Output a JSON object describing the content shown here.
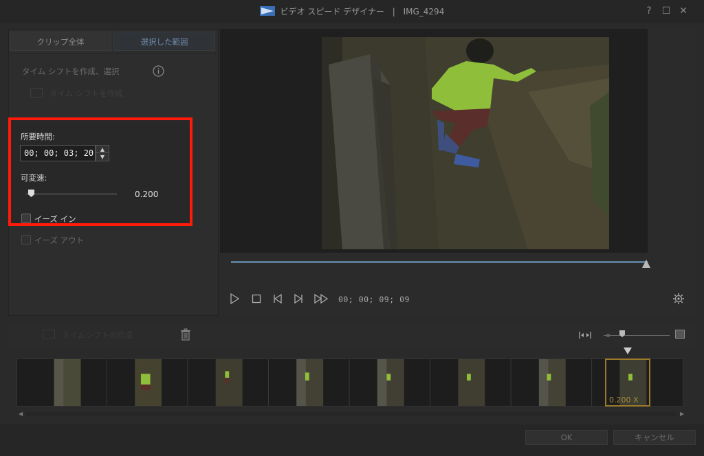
{
  "window": {
    "title": "ビデオ スピード デザイナー",
    "separator": "|",
    "filename": "IMG_4294",
    "help_glyph": "?",
    "maximize_glyph": "☐",
    "close_glyph": "✕"
  },
  "tabs": [
    {
      "label": "クリップ全体"
    },
    {
      "label": "選択した範囲"
    }
  ],
  "left_panel": {
    "section_label": "タイム シフトを作成、選択",
    "create_button_label": "タイム シフトを作成",
    "duration_label": "所要時間:",
    "duration_value": "00; 00; 03; 20",
    "speed_label": "可変速:",
    "speed_value": "0.200",
    "speed_level_fraction": 0.03,
    "ease_in_label": "イーズ イン",
    "ease_out_label": "イーズ アウト",
    "ease_in_checked": false,
    "ease_out_checked": false
  },
  "player": {
    "timecode": "00; 00; 09; 09",
    "progress_fraction": 0.99
  },
  "timeline": {
    "create_label": "タイムシフトの作成",
    "range_label": "0.200 X",
    "thumbnails": 8
  },
  "footer": {
    "ok_label": "OK",
    "cancel_label": "キャンセル"
  },
  "colors": {
    "highlight": "#ff1a0a",
    "accent_blue": "#5b7a96",
    "range_gold": "#9b7a2a"
  }
}
